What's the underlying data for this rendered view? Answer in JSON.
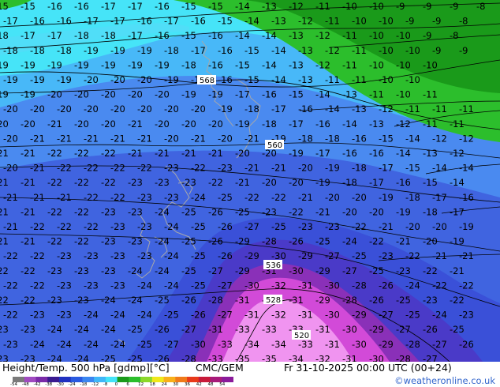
{
  "footer": {
    "product": "Height/Temp. 500 hPa [gdmp][°C]",
    "model": "CMC/GEM",
    "valid_time": "Fr 31-10-2025 00:00 UTC (00+24)",
    "watermark": "©weatheronline.co.uk"
  },
  "colorbar": {
    "labels": [
      "-54",
      "-48",
      "-42",
      "-38",
      "-30",
      "-24",
      "-18",
      "-12",
      "-8",
      "0",
      "6",
      "12",
      "18",
      "24",
      "30",
      "36",
      "42",
      "48",
      "54"
    ],
    "colors": [
      "#7a7a7a",
      "#a04ac0",
      "#7a2aa8",
      "#3a1a90",
      "#2030c0",
      "#2a5ae0",
      "#3a86f0",
      "#40b8f8",
      "#44e4f8",
      "#1a9a1a",
      "#2cbe2c",
      "#8cd82a",
      "#f0e81a",
      "#f8b01a",
      "#f07a1a",
      "#e83a1a",
      "#c81a3a",
      "#a81a7a",
      "#8a1a9a"
    ]
  },
  "contours": {
    "height_labels": [
      "568",
      "560",
      "536",
      "528",
      "520"
    ]
  },
  "grid_temperatures": [
    {
      "row": [
        "-15",
        "-15",
        "-16",
        "-16",
        "-17",
        "-17",
        "-16",
        "-15",
        "-15",
        "-14",
        "-13",
        "-12",
        "-11",
        "-10",
        "-10",
        "-9",
        "-9",
        "-9",
        "-8"
      ]
    },
    {
      "row": [
        "-17",
        "-16",
        "-16",
        "-17",
        "-17",
        "-16",
        "-17",
        "-16",
        "-15",
        "-14",
        "-13",
        "-12",
        "-11",
        "-10",
        "-10",
        "-9",
        "-9",
        "-8"
      ]
    },
    {
      "row": [
        "-18",
        "-17",
        "-17",
        "-18",
        "-18",
        "-17",
        "-16",
        "-15",
        "-16",
        "-14",
        "-14",
        "-13",
        "-12",
        "-11",
        "-10",
        "-10",
        "-9",
        "-8"
      ]
    },
    {
      "row": [
        "-18",
        "-18",
        "-18",
        "-19",
        "-19",
        "-19",
        "-18",
        "-17",
        "-16",
        "-15",
        "-14",
        "-13",
        "-12",
        "-11",
        "-10",
        "-10",
        "-9",
        "-9"
      ]
    },
    {
      "row": [
        "-19",
        "-19",
        "-19",
        "-19",
        "-19",
        "-19",
        "-19",
        "-18",
        "-16",
        "-15",
        "-14",
        "-13",
        "-12",
        "-11",
        "-10",
        "-10",
        "-10"
      ]
    },
    {
      "row": [
        "-19",
        "-19",
        "-19",
        "-20",
        "-20",
        "-20",
        "-19",
        "-18",
        "-16",
        "-15",
        "-14",
        "-13",
        "-11",
        "-11",
        "-10",
        "-10"
      ]
    },
    {
      "row": [
        "-19",
        "-19",
        "-20",
        "-20",
        "-20",
        "-20",
        "-20",
        "-19",
        "-19",
        "-17",
        "-16",
        "-15",
        "-14",
        "-13",
        "-11",
        "-10",
        "-11"
      ]
    },
    {
      "row": [
        "-20",
        "-20",
        "-20",
        "-20",
        "-20",
        "-20",
        "-20",
        "-20",
        "-19",
        "-18",
        "-17",
        "-16",
        "-14",
        "-13",
        "-12",
        "-11",
        "-11",
        "-11"
      ]
    },
    {
      "row": [
        "-20",
        "-20",
        "-21",
        "-20",
        "-20",
        "-21",
        "-20",
        "-20",
        "-20",
        "-19",
        "-18",
        "-17",
        "-16",
        "-14",
        "-13",
        "-12",
        "-11",
        "-11"
      ]
    },
    {
      "row": [
        "-20",
        "-21",
        "-21",
        "-21",
        "-21",
        "-21",
        "-20",
        "-21",
        "-20",
        "-21",
        "-19",
        "-18",
        "-18",
        "-16",
        "-15",
        "-14",
        "-12",
        "-12"
      ]
    },
    {
      "row": [
        "-21",
        "-21",
        "-22",
        "-22",
        "-22",
        "-21",
        "-21",
        "-21",
        "-21",
        "-20",
        "-20",
        "-19",
        "-17",
        "-16",
        "-16",
        "-14",
        "-13",
        "-12"
      ]
    },
    {
      "row": [
        "-20",
        "-21",
        "-22",
        "-22",
        "-22",
        "-22",
        "-23",
        "-22",
        "-23",
        "-21",
        "-21",
        "-20",
        "-19",
        "-18",
        "-17",
        "-15",
        "-14",
        "-14"
      ]
    },
    {
      "row": [
        "-21",
        "-21",
        "-22",
        "-22",
        "-22",
        "-23",
        "-23",
        "-23",
        "-22",
        "-21",
        "-20",
        "-20",
        "-19",
        "-18",
        "-17",
        "-16",
        "-15",
        "-14"
      ]
    },
    {
      "row": [
        "-21",
        "-21",
        "-21",
        "-22",
        "-22",
        "-23",
        "-23",
        "-24",
        "-25",
        "-22",
        "-22",
        "-21",
        "-20",
        "-20",
        "-19",
        "-18",
        "-17",
        "-16"
      ]
    },
    {
      "row": [
        "-21",
        "-21",
        "-22",
        "-22",
        "-23",
        "-23",
        "-24",
        "-25",
        "-26",
        "-25",
        "-23",
        "-22",
        "-21",
        "-20",
        "-20",
        "-19",
        "-18",
        "-17"
      ]
    },
    {
      "row": [
        "-21",
        "-22",
        "-22",
        "-22",
        "-23",
        "-23",
        "-24",
        "-25",
        "-26",
        "-27",
        "-25",
        "-23",
        "-23",
        "-22",
        "-21",
        "-20",
        "-20",
        "-19"
      ]
    },
    {
      "row": [
        "-21",
        "-21",
        "-22",
        "-22",
        "-23",
        "-23",
        "-24",
        "-25",
        "-26",
        "-29",
        "-28",
        "-26",
        "-25",
        "-24",
        "-22",
        "-21",
        "-20",
        "-19"
      ]
    },
    {
      "row": [
        "-22",
        "-22",
        "-23",
        "-23",
        "-23",
        "-23",
        "-24",
        "-25",
        "-26",
        "-29",
        "-30",
        "-29",
        "-27",
        "-25",
        "-23",
        "-22",
        "-21",
        "-21"
      ]
    },
    {
      "row": [
        "-22",
        "-22",
        "-23",
        "-23",
        "-23",
        "-24",
        "-24",
        "-25",
        "-27",
        "-29",
        "-31",
        "-30",
        "-29",
        "-27",
        "-25",
        "-23",
        "-22",
        "-21"
      ]
    },
    {
      "row": [
        "-22",
        "-22",
        "-23",
        "-23",
        "-23",
        "-24",
        "-24",
        "-25",
        "-27",
        "-30",
        "-32",
        "-31",
        "-30",
        "-28",
        "-26",
        "-24",
        "-22",
        "-22"
      ]
    },
    {
      "row": [
        "-22",
        "-22",
        "-23",
        "-23",
        "-24",
        "-24",
        "-25",
        "-26",
        "-28",
        "-31",
        "-32",
        "-31",
        "-29",
        "-28",
        "-26",
        "-25",
        "-23",
        "-22"
      ]
    },
    {
      "row": [
        "-22",
        "-23",
        "-23",
        "-24",
        "-24",
        "-24",
        "-25",
        "-26",
        "-27",
        "-31",
        "-32",
        "-31",
        "-30",
        "-29",
        "-27",
        "-25",
        "-24",
        "-23"
      ]
    },
    {
      "row": [
        "-23",
        "-23",
        "-24",
        "-24",
        "-24",
        "-25",
        "-26",
        "-27",
        "-31",
        "-33",
        "-33",
        "-33",
        "-31",
        "-30",
        "-29",
        "-27",
        "-26",
        "-25"
      ]
    },
    {
      "row": [
        "-23",
        "-24",
        "-24",
        "-24",
        "-24",
        "-25",
        "-27",
        "-30",
        "-33",
        "-34",
        "-34",
        "-33",
        "-31",
        "-30",
        "-29",
        "-28",
        "-27",
        "-26"
      ]
    },
    {
      "row": [
        "-23",
        "-23",
        "-24",
        "-24",
        "-25",
        "-25",
        "-26",
        "-28",
        "-33",
        "-35",
        "-35",
        "-34",
        "-32",
        "-31",
        "-30",
        "-28",
        "-27"
      ]
    }
  ]
}
